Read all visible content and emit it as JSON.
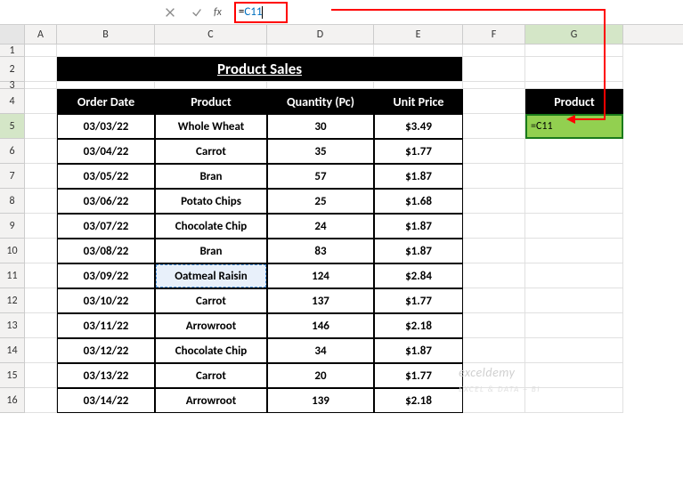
{
  "formula_bar": {
    "fx_label": "fx",
    "formula_prefix": "=",
    "formula_ref": "C11"
  },
  "columns": [
    "A",
    "B",
    "C",
    "D",
    "E",
    "F",
    "G"
  ],
  "rows": [
    "1",
    "2",
    "3",
    "4",
    "5",
    "6",
    "7",
    "8",
    "9",
    "10",
    "11",
    "12",
    "13",
    "14",
    "15",
    "16"
  ],
  "title": "Product Sales",
  "headers": {
    "b": "Order Date",
    "c": "Product",
    "d": "Quantity (Pc)",
    "e": "Unit Price"
  },
  "g4_header": "Product",
  "g5_value": "=C11",
  "data": [
    {
      "date": "03/03/22",
      "product": "Whole Wheat",
      "qty": "30",
      "price": "$3.49"
    },
    {
      "date": "03/04/22",
      "product": "Carrot",
      "qty": "35",
      "price": "$1.77"
    },
    {
      "date": "03/05/22",
      "product": "Bran",
      "qty": "57",
      "price": "$1.87"
    },
    {
      "date": "03/06/22",
      "product": "Potato Chips",
      "qty": "25",
      "price": "$1.68"
    },
    {
      "date": "03/07/22",
      "product": "Chocolate Chip",
      "qty": "24",
      "price": "$1.87"
    },
    {
      "date": "03/08/22",
      "product": "Bran",
      "qty": "83",
      "price": "$1.87"
    },
    {
      "date": "03/09/22",
      "product": "Oatmeal Raisin",
      "qty": "124",
      "price": "$2.84"
    },
    {
      "date": "03/10/22",
      "product": "Carrot",
      "qty": "137",
      "price": "$1.77"
    },
    {
      "date": "03/11/22",
      "product": "Arrowroot",
      "qty": "146",
      "price": "$2.18"
    },
    {
      "date": "03/12/22",
      "product": "Chocolate Chip",
      "qty": "34",
      "price": "$1.87"
    },
    {
      "date": "03/13/22",
      "product": "Carrot",
      "qty": "20",
      "price": "$1.77"
    },
    {
      "date": "03/14/22",
      "product": "Arrowroot",
      "qty": "139",
      "price": "$2.18"
    }
  ],
  "watermark": {
    "main": "exceldemy",
    "sub": "EXCEL & DATA + BI"
  }
}
